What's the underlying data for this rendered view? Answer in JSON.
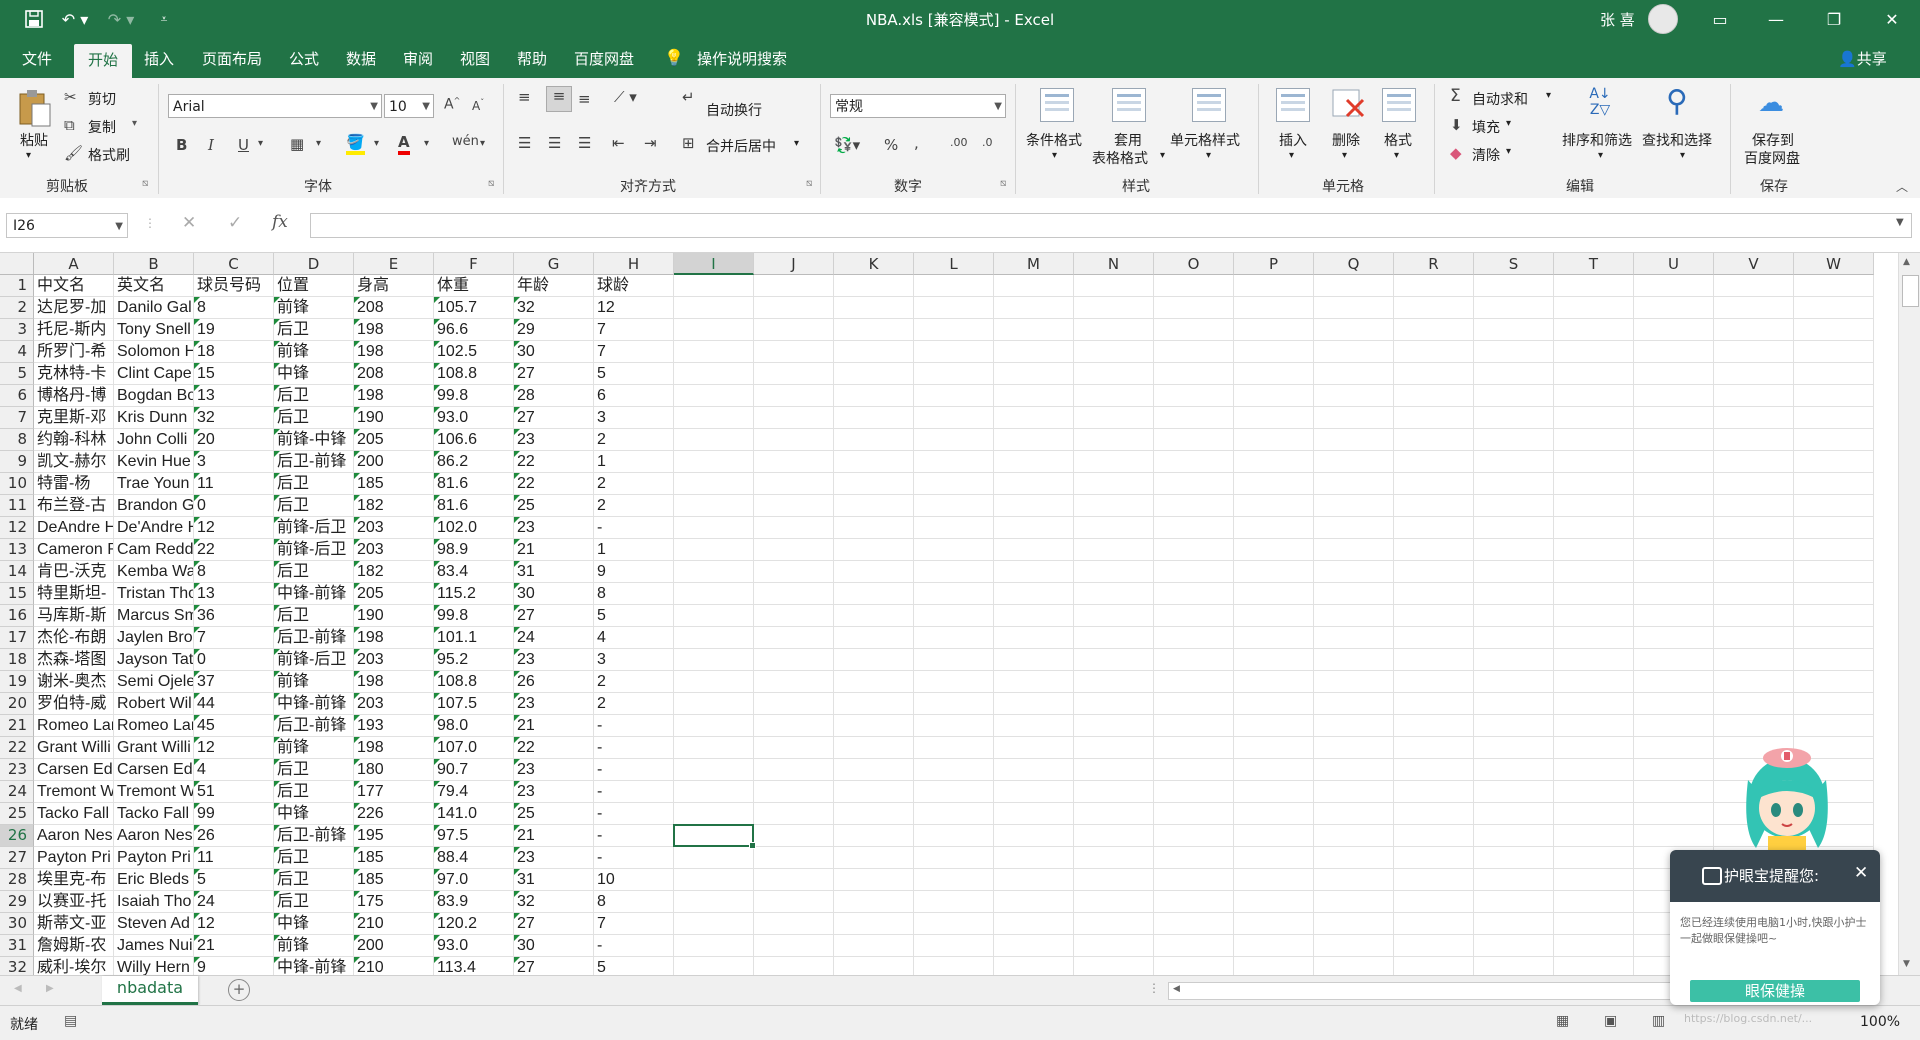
{
  "window": {
    "title": "NBA.xls  [兼容模式]  -  Excel",
    "user": "张 喜",
    "share": "共享"
  },
  "tabs": [
    "文件",
    "开始",
    "插入",
    "页面布局",
    "公式",
    "数据",
    "审阅",
    "视图",
    "帮助",
    "百度网盘",
    "操作说明搜索"
  ],
  "ribbon": {
    "clipboard": {
      "paste": "粘贴",
      "cut": "剪切",
      "copy": "复制",
      "format_painter": "格式刷",
      "group": "剪贴板"
    },
    "font": {
      "family": "Arial",
      "size": "10",
      "bold": "B",
      "italic": "I",
      "underline": "U",
      "group": "字体"
    },
    "alignment": {
      "wrap": "自动换行",
      "merge": "合并后居中",
      "group": "对齐方式"
    },
    "number": {
      "format": "常规",
      "group": "数字"
    },
    "styles": {
      "conditional": "条件格式",
      "table1": "套用",
      "table2": "表格格式",
      "cell_styles": "单元格样式",
      "group": "样式"
    },
    "cells": {
      "insert": "插入",
      "delete": "删除",
      "format": "格式",
      "group": "单元格"
    },
    "editing": {
      "autosum": "自动求和",
      "fill": "填充",
      "clear": "清除",
      "sort": "排序和筛选",
      "find": "查找和选择",
      "group": "编辑"
    },
    "save": {
      "label1": "保存到",
      "label2": "百度网盘",
      "group": "保存"
    }
  },
  "formula_bar": {
    "name_box": "I26",
    "formula": ""
  },
  "columns": [
    "A",
    "B",
    "C",
    "D",
    "E",
    "F",
    "G",
    "H",
    "I",
    "J",
    "K",
    "L",
    "M",
    "N",
    "O",
    "P",
    "Q",
    "R",
    "S",
    "T",
    "U",
    "V",
    "W"
  ],
  "selected_cell": "I26",
  "rows": [
    [
      "中文名",
      "英文名",
      "球员号码",
      "位置",
      "身高",
      "体重",
      "年龄",
      "球龄"
    ],
    [
      "达尼罗-加",
      "Danilo Gal",
      "8",
      "前锋",
      "208",
      "105.7",
      "32",
      "12"
    ],
    [
      "托尼-斯内",
      "Tony Snell",
      "19",
      "后卫",
      "198",
      "96.6",
      "29",
      "7"
    ],
    [
      "所罗门-希",
      "Solomon H",
      "18",
      "前锋",
      "198",
      "102.5",
      "30",
      "7"
    ],
    [
      "克林特-卡",
      "Clint Cape",
      "15",
      "中锋",
      "208",
      "108.8",
      "27",
      "5"
    ],
    [
      "博格丹-博",
      "Bogdan Bo",
      "13",
      "后卫",
      "198",
      "99.8",
      "28",
      "6"
    ],
    [
      "克里斯-邓",
      "Kris Dunn",
      "32",
      "后卫",
      "190",
      "93.0",
      "27",
      "3"
    ],
    [
      "约翰-科林",
      "John Colli",
      "20",
      "前锋-中锋",
      "205",
      "106.6",
      "23",
      "2"
    ],
    [
      "凯文-赫尔",
      "Kevin Hue",
      "3",
      "后卫-前锋",
      "200",
      "86.2",
      "22",
      "1"
    ],
    [
      "特雷-杨",
      "Trae Youn",
      "11",
      "后卫",
      "185",
      "81.6",
      "22",
      "2"
    ],
    [
      "布兰登-古",
      "Brandon G",
      "0",
      "后卫",
      "182",
      "81.6",
      "25",
      "2"
    ],
    [
      "DeAndre H",
      "De'Andre H",
      "12",
      "前锋-后卫",
      "203",
      "102.0",
      "23",
      "-"
    ],
    [
      "Cameron R",
      "Cam Redd",
      "22",
      "前锋-后卫",
      "203",
      "98.9",
      "21",
      "1"
    ],
    [
      "肯巴-沃克",
      "Kemba Wa",
      "8",
      "后卫",
      "182",
      "83.4",
      "31",
      "9"
    ],
    [
      "特里斯坦-",
      "Tristan Tho",
      "13",
      "中锋-前锋",
      "205",
      "115.2",
      "30",
      "8"
    ],
    [
      "马库斯-斯",
      "Marcus Sm",
      "36",
      "后卫",
      "190",
      "99.8",
      "27",
      "5"
    ],
    [
      "杰伦-布朗",
      "Jaylen Bro",
      "7",
      "后卫-前锋",
      "198",
      "101.1",
      "24",
      "4"
    ],
    [
      "杰森-塔图",
      "Jayson Tat",
      "0",
      "前锋-后卫",
      "203",
      "95.2",
      "23",
      "3"
    ],
    [
      "谢米-奥杰",
      "Semi Ojele",
      "37",
      "前锋",
      "198",
      "108.8",
      "26",
      "2"
    ],
    [
      "罗伯特-威",
      "Robert Wil",
      "44",
      "中锋-前锋",
      "203",
      "107.5",
      "23",
      "2"
    ],
    [
      "Romeo Lan",
      "Romeo Lan",
      "45",
      "后卫-前锋",
      "193",
      "98.0",
      "21",
      "-"
    ],
    [
      "Grant Willi",
      "Grant Willi",
      "12",
      "前锋",
      "198",
      "107.0",
      "22",
      "-"
    ],
    [
      "Carsen Ed",
      "Carsen Ed",
      "4",
      "后卫",
      "180",
      "90.7",
      "23",
      "-"
    ],
    [
      "Tremont W",
      "Tremont W",
      "51",
      "后卫",
      "177",
      "79.4",
      "23",
      "-"
    ],
    [
      "Tacko Fall",
      "Tacko Fall",
      "99",
      "中锋",
      "226",
      "141.0",
      "25",
      "-"
    ],
    [
      "Aaron Nes",
      "Aaron Nes",
      "26",
      "后卫-前锋",
      "195",
      "97.5",
      "21",
      "-"
    ],
    [
      "Payton Pri",
      "Payton Pri",
      "11",
      "后卫",
      "185",
      "88.4",
      "23",
      "-"
    ],
    [
      "埃里克-布",
      "Eric Bleds",
      "5",
      "后卫",
      "185",
      "97.0",
      "31",
      "10"
    ],
    [
      "以赛亚-托",
      "Isaiah Tho",
      "24",
      "后卫",
      "175",
      "83.9",
      "32",
      "8"
    ],
    [
      "斯蒂文-亚",
      "Steven Ad",
      "12",
      "中锋",
      "210",
      "120.2",
      "27",
      "7"
    ],
    [
      "詹姆斯-农",
      "James Nui",
      "21",
      "前锋",
      "200",
      "93.0",
      "30",
      "-"
    ],
    [
      "威利-埃尔",
      "Willy Hern",
      "9",
      "中锋-前锋",
      "210",
      "113.4",
      "27",
      "5"
    ]
  ],
  "sheet": {
    "name": "nbadata"
  },
  "status": {
    "ready": "就绪",
    "zoom": "100%"
  },
  "popup": {
    "title": "护眼宝提醒您:",
    "message": "您已经连续使用电脑1小时,快跟小护士一起做眼保健操吧~",
    "button": "眼保健操"
  },
  "watermark": "https://blog.csdn.net/..."
}
